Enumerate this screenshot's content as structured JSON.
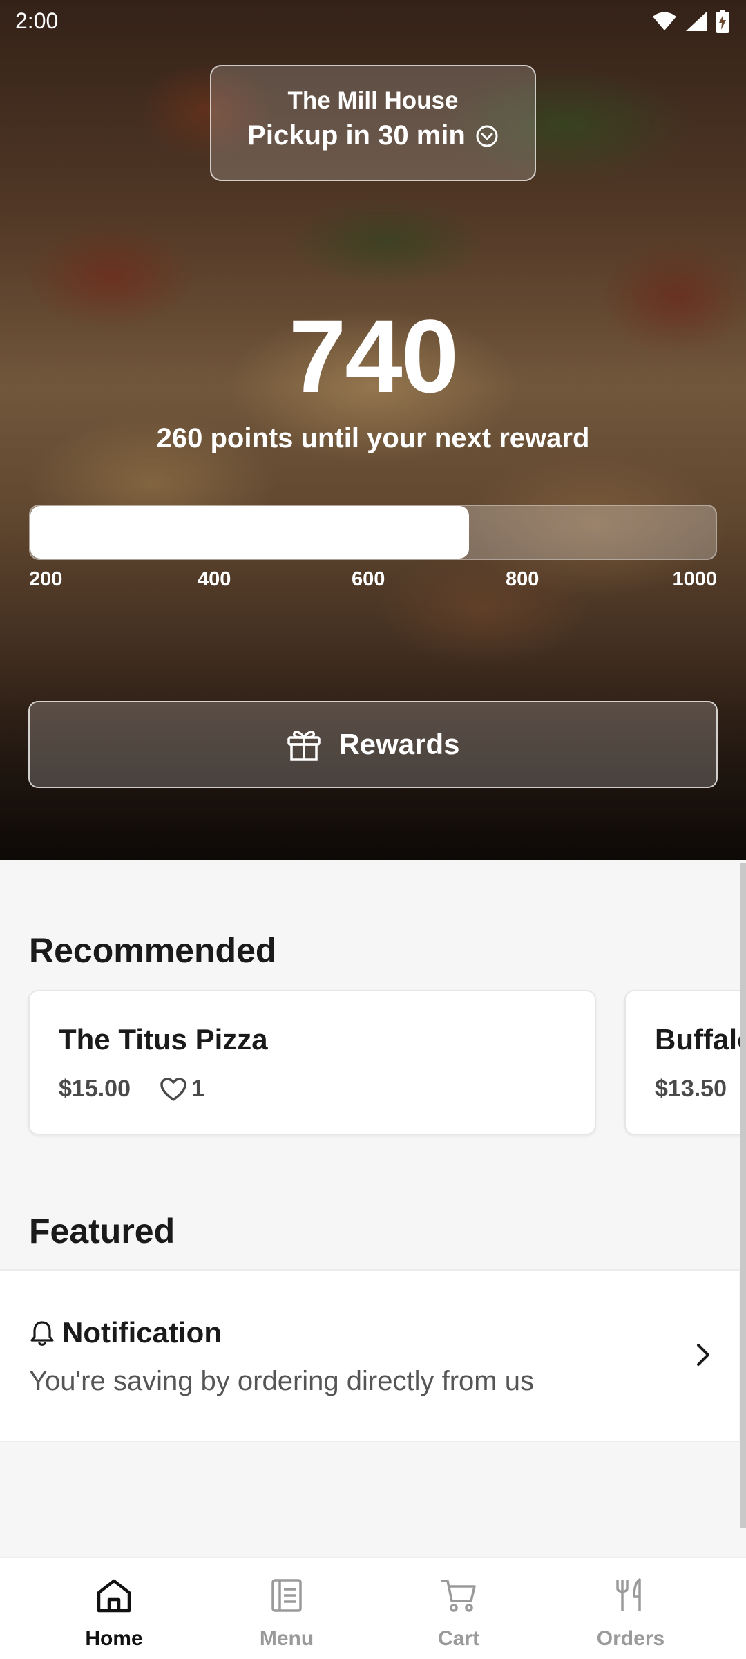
{
  "status_bar": {
    "time": "2:00"
  },
  "location": {
    "name": "The Mill House",
    "pickup": "Pickup in 30 min"
  },
  "loyalty": {
    "points": "740",
    "subtitle": "260 points until your next reward",
    "progress_fraction": 0.64,
    "ticks": [
      "200",
      "400",
      "600",
      "800",
      "1000"
    ]
  },
  "rewards_button": {
    "label": "Rewards"
  },
  "recommended": {
    "title": "Recommended",
    "items": [
      {
        "name": "The Titus Pizza",
        "price": "$15.00",
        "likes": "1"
      },
      {
        "name": "Buffalo",
        "price": "$13.50"
      }
    ]
  },
  "featured": {
    "title": "Featured",
    "notification": {
      "title": "Notification",
      "body": "You're saving by ordering directly from us"
    }
  },
  "nav": {
    "items": [
      {
        "label": "Home",
        "icon": "home-icon",
        "active": true
      },
      {
        "label": "Menu",
        "icon": "menu-icon",
        "active": false
      },
      {
        "label": "Cart",
        "icon": "cart-icon",
        "active": false
      },
      {
        "label": "Orders",
        "icon": "orders-icon",
        "active": false
      }
    ]
  },
  "colors": {
    "accent": "#111111",
    "inactive": "#9a9a9a",
    "background": "#f6f6f6"
  }
}
